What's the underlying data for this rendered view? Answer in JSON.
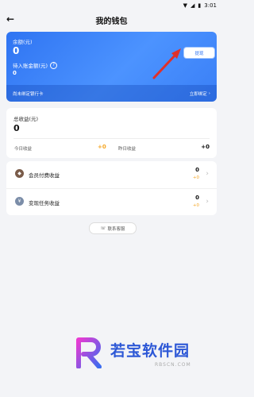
{
  "status_bar": {
    "time": "3:01"
  },
  "header": {
    "title": "我的钱包"
  },
  "balance": {
    "label": "余额(元)",
    "amount": "0",
    "pending_label": "待入账金额(元)",
    "pending_amount": "0",
    "withdraw_label": "提现",
    "card_notice": "尚未绑定银行卡",
    "bind_label": "立即绑定"
  },
  "earnings": {
    "label": "总收益(元)",
    "amount": "0",
    "today_label": "今日收益",
    "today_value": "+0",
    "yesterday_label": "昨日收益",
    "yesterday_value": "+0"
  },
  "income_list": [
    {
      "name": "会员付费收益",
      "value": "0",
      "change": "+0",
      "icon": "member-icon"
    },
    {
      "name": "变现任务收益",
      "value": "0",
      "change": "+0",
      "icon": "task-icon"
    }
  ],
  "service": {
    "label": "联系客服"
  },
  "watermark": {
    "text": "若宝软件园",
    "url": "RBSCN.COM"
  },
  "colors": {
    "accent": "#2f74f2",
    "gain": "#f5a623",
    "annotation": "#e0302a"
  }
}
